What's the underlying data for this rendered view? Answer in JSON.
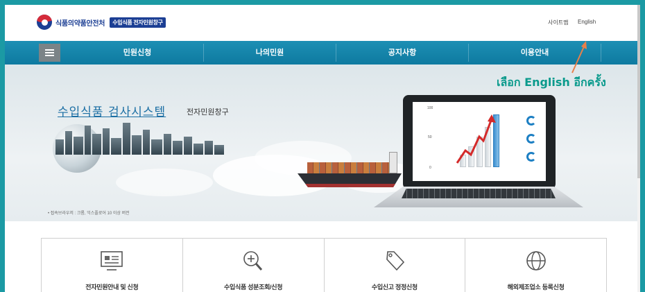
{
  "header": {
    "logo_text": "식품의약품안전처",
    "logo_badge": "수입식품 전자민원창구",
    "util_links": {
      "sitemap": "사이트맵",
      "english": "English"
    }
  },
  "nav": {
    "menu_icon": "hamburger-icon",
    "items": [
      {
        "label": "민원신청"
      },
      {
        "label": "나의민원"
      },
      {
        "label": "공지사항"
      },
      {
        "label": "이용안내"
      }
    ]
  },
  "annotation": {
    "text": "เลือก English อีกครั้ง",
    "color": "#0a9a8c"
  },
  "banner": {
    "title_main": "수입식품 검사시스템",
    "title_sub": "전자민원창구",
    "note": "• 접속브라우저 : 크롬, 익스플로어 10 이상 버전",
    "chart_labels": [
      "100",
      "50",
      "0"
    ]
  },
  "cards": [
    {
      "label": "전자민원안내 및 신청",
      "icon": "monitor-icon"
    },
    {
      "label": "수입식품 성분조회/신청",
      "icon": "search-zoom-icon"
    },
    {
      "label": "수입신고 정정신청",
      "icon": "tag-icon"
    },
    {
      "label": "해외제조업소 등록신청",
      "icon": "globe-icon"
    }
  ],
  "colors": {
    "nav_bg": "#1585ab",
    "brand_blue": "#1c3f94",
    "frame_teal": "#1b9aa4",
    "annotation_teal": "#0a9a8c"
  }
}
